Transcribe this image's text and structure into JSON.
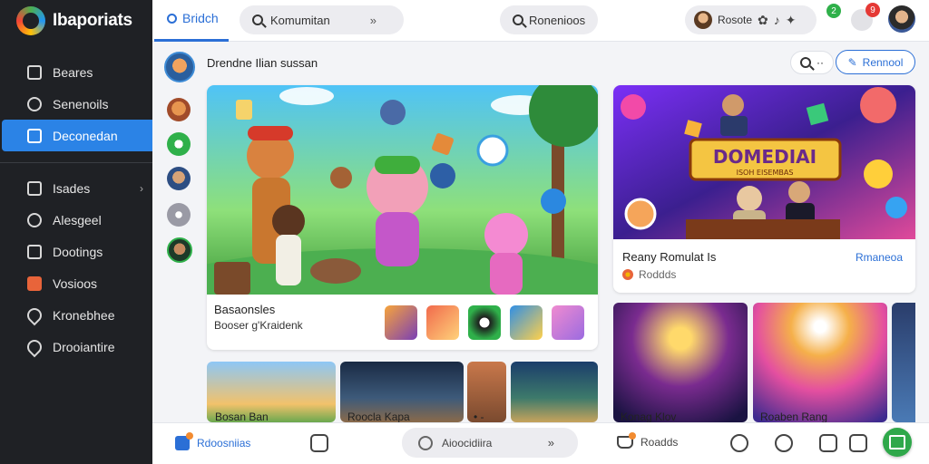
{
  "brand": {
    "name": "Ibaporiats"
  },
  "sidebar": {
    "items": [
      {
        "label": "Beares",
        "icon": "document-icon"
      },
      {
        "label": "Senenoils",
        "icon": "user-icon"
      },
      {
        "label": "Deconedan",
        "icon": "calendar-icon",
        "active": true
      },
      {
        "label": "Isades",
        "icon": "inbox-icon"
      },
      {
        "label": "Alesgeel",
        "icon": "message-icon"
      },
      {
        "label": "Dootings",
        "icon": "checkbox-icon"
      },
      {
        "label": "Vosioos",
        "icon": "mail-icon"
      },
      {
        "label": "Kronebhee",
        "icon": "pin-icon"
      },
      {
        "label": "Drooiantire",
        "icon": "pin-icon"
      }
    ]
  },
  "topbar": {
    "home_tab": "Bridch",
    "search_pill": "Komumitan",
    "search_pill2": "Ronenioos",
    "user_pill": "Rosote",
    "green_badge": "2",
    "red_badge": "9",
    "arrows_glyph": "»"
  },
  "main": {
    "title": "Drendne Ilian sussan",
    "search_dots": "··",
    "primary_button": "Rennool"
  },
  "hero": {
    "title": "Basaonsles",
    "subtitle": "Booser g'Kraidenk"
  },
  "featured": {
    "banner_text": "DOMEDIAI",
    "banner_sub": "ISOH EISEMBAS",
    "title": "Reany Romulat Is",
    "link": "Rmaneoa",
    "sub": "Roddds"
  },
  "small_cards": {
    "label1": "Bosan Ban",
    "label2": "Roocla Kapa",
    "label3": "•  -"
  },
  "game_cards": {
    "label1": "Konag Klov",
    "label2": "Roaben Rang"
  },
  "bottombar": {
    "left_label": "Rdoosniias",
    "center_label": "Aioocidiira",
    "reads_label": "Roadds"
  },
  "colors": {
    "accent": "#2b6fd6",
    "sidebar_bg": "#1f2125",
    "active_item": "#2b83e6",
    "fab": "#2fa84a"
  }
}
